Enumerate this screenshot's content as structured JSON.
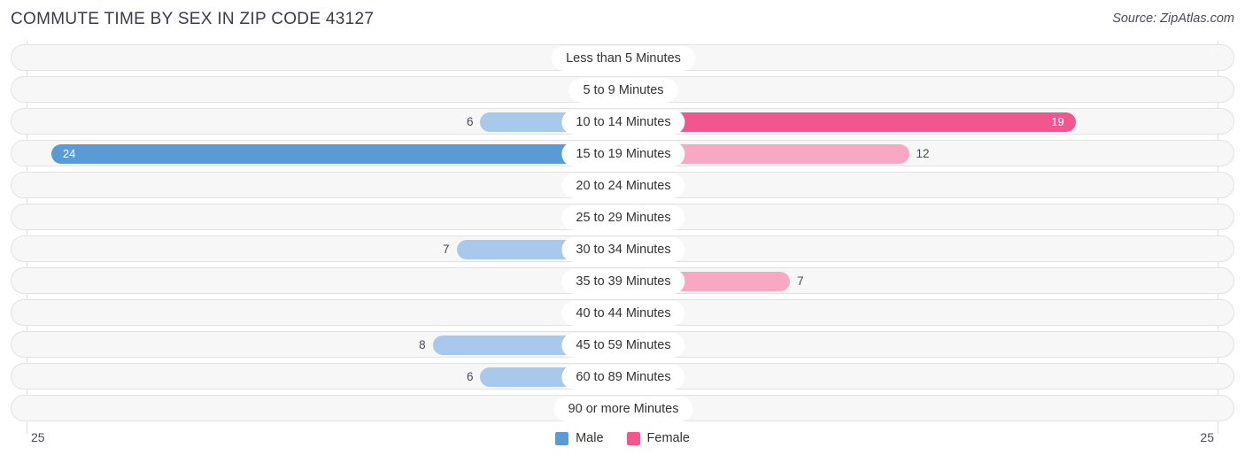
{
  "header": {
    "title": "COMMUTE TIME BY SEX IN ZIP CODE 43127",
    "source": "Source: ZipAtlas.com"
  },
  "axis": {
    "left_label": "25",
    "right_label": "25"
  },
  "legend": {
    "items": [
      {
        "label": "Male",
        "color": "#5b9bd5"
      },
      {
        "label": "Female",
        "color": "#f2568f"
      }
    ]
  },
  "colors": {
    "male_strong": "#5b9bd5",
    "male_light": "#a8c8ec",
    "female_strong": "#f2568f",
    "female_light": "#f9a8c4",
    "track": "#f7f7f7",
    "track_border": "#e2e2e2",
    "gridline": "#dddddd",
    "text": "#4a4a55"
  },
  "chart_data": {
    "type": "bar",
    "subtype": "diverging-population-pyramid",
    "title": "COMMUTE TIME BY SEX IN ZIP CODE 43127",
    "xlabel": "",
    "ylabel": "",
    "xlim": [
      25,
      25
    ],
    "axis_max": 25,
    "grid": true,
    "legend_position": "bottom-center",
    "categories": [
      "Less than 5 Minutes",
      "5 to 9 Minutes",
      "10 to 14 Minutes",
      "15 to 19 Minutes",
      "20 to 24 Minutes",
      "25 to 29 Minutes",
      "30 to 34 Minutes",
      "35 to 39 Minutes",
      "40 to 44 Minutes",
      "45 to 59 Minutes",
      "60 to 89 Minutes",
      "90 or more Minutes"
    ],
    "series": [
      {
        "name": "Male",
        "side": "left",
        "color": "#5b9bd5",
        "values": [
          0,
          0,
          6,
          24,
          0,
          0,
          7,
          0,
          0,
          8,
          6,
          0
        ]
      },
      {
        "name": "Female",
        "side": "right",
        "color": "#f2568f",
        "values": [
          0,
          0,
          19,
          12,
          0,
          0,
          0,
          7,
          0,
          0,
          0,
          0
        ]
      }
    ]
  }
}
